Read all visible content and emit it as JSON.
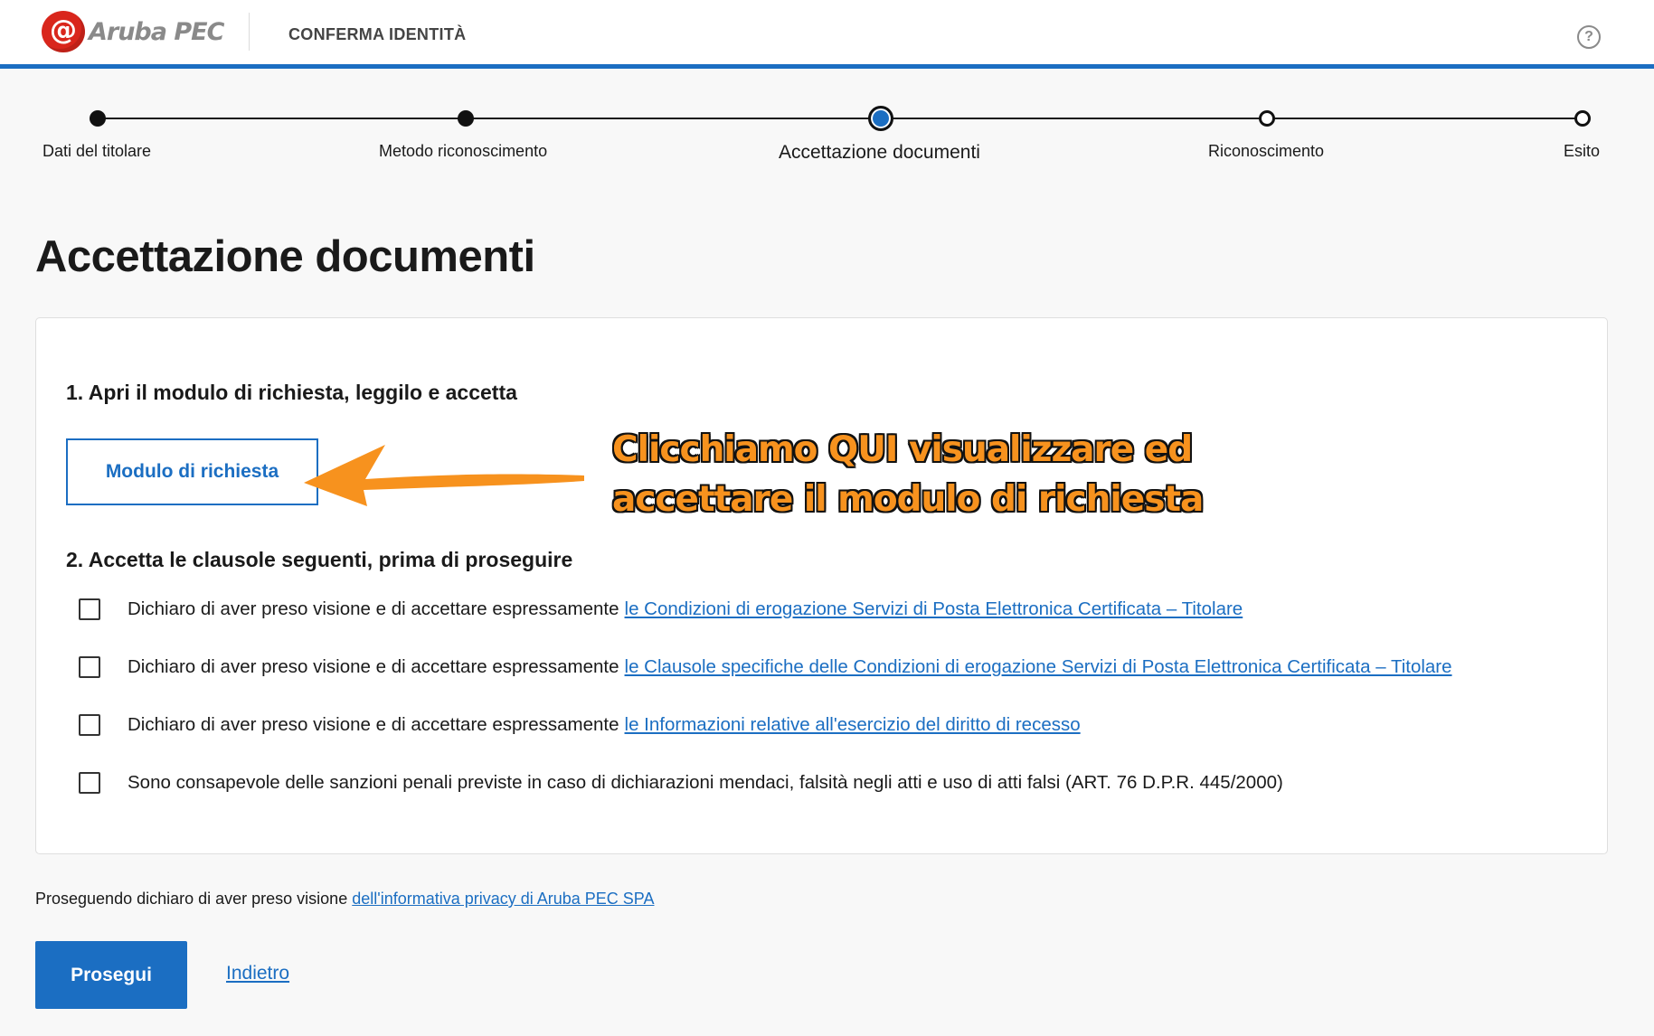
{
  "header": {
    "logo_text": "Aruba PEC",
    "logo_mark": "@",
    "title": "CONFERMA IDENTITÀ",
    "help_icon": "?"
  },
  "stepper": {
    "steps": [
      {
        "label": "Dati del titolare",
        "state": "done"
      },
      {
        "label": "Metodo riconoscimento",
        "state": "done"
      },
      {
        "label": "Accettazione documenti",
        "state": "current"
      },
      {
        "label": "Riconoscimento",
        "state": "todo"
      },
      {
        "label": "Esito",
        "state": "todo"
      }
    ]
  },
  "page_title": "Accettazione documenti",
  "section1": {
    "number": "1.",
    "title": "Apri il modulo di richiesta, leggilo e accetta",
    "button_label": "Modulo di richiesta"
  },
  "annotation": {
    "line1": "Clicchiamo QUI visualizzare ed",
    "line2": "accettare il modulo di richiesta"
  },
  "section2": {
    "number": "2.",
    "title": "Accetta le clausole seguenti, prima di proseguire",
    "clauses": [
      {
        "text": "Dichiaro di aver preso visione e di accettare espressamente",
        "link": "le Condizioni di erogazione Servizi di Posta Elettronica Certificata – Titolare",
        "checked": false
      },
      {
        "text": "Dichiaro di aver preso visione e di accettare espressamente",
        "link": "le Clausole specifiche delle Condizioni di erogazione Servizi di Posta Elettronica Certificata – Titolare",
        "checked": false
      },
      {
        "text": "Dichiaro di aver preso visione e di accettare espressamente",
        "link": "le Informazioni relative all'esercizio del diritto di recesso",
        "checked": false
      },
      {
        "text": "Sono consapevole delle sanzioni penali previste in caso di dichiarazioni mendaci, falsità negli atti e uso di atti falsi (ART. 76 D.P.R. 445/2000)",
        "link": "",
        "checked": false
      }
    ]
  },
  "footer": {
    "privacy_text": "Proseguendo dichiaro di aver preso visione",
    "privacy_link": "dell'informativa privacy di Aruba PEC SPA",
    "primary_button": "Prosegui",
    "back_link": "Indietro"
  },
  "colors": {
    "accent": "#1b6ec2",
    "brand_red": "#d9261c",
    "annotation_orange": "#f7921e"
  }
}
